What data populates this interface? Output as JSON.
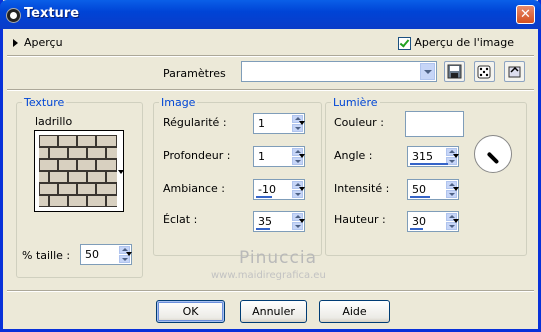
{
  "window": {
    "title": "Texture",
    "close_symbol": "✕"
  },
  "preview_toggle": {
    "label": "Aperçu"
  },
  "preview_checkbox": {
    "label": "Aperçu de l'image",
    "checked": true
  },
  "presets": {
    "label": "Paramètres",
    "value": ""
  },
  "texture_group": {
    "title": "Texture",
    "name": "ladrillo",
    "size_label": "% taille :",
    "size_value": "50"
  },
  "image_group": {
    "title": "Image",
    "fields": [
      {
        "label": "Régularité :",
        "value": "1"
      },
      {
        "label": "Profondeur :",
        "value": "1"
      },
      {
        "label": "Ambiance :",
        "value": "-10"
      },
      {
        "label": "Éclat :",
        "value": "35"
      }
    ]
  },
  "light_group": {
    "title": "Lumière",
    "color_label": "Couleur :",
    "color_value": "#ffffff",
    "fields": [
      {
        "label": "Angle :",
        "value": "315"
      },
      {
        "label": "Intensité :",
        "value": "50"
      },
      {
        "label": "Hauteur :",
        "value": "30"
      }
    ]
  },
  "watermark": {
    "line1": "Pinuccia",
    "line2": "www.maidiregrafica.eu"
  },
  "buttons": {
    "ok": "OK",
    "cancel": "Annuler",
    "help": "Aide"
  },
  "colors": {
    "title_bar": "#0054e3",
    "group_title": "#0046d5",
    "dialog_bg": "#ece9d8"
  },
  "icons": [
    "window-menu-icon",
    "close-icon",
    "save-preset-icon",
    "randomize-icon",
    "reset-icon"
  ]
}
